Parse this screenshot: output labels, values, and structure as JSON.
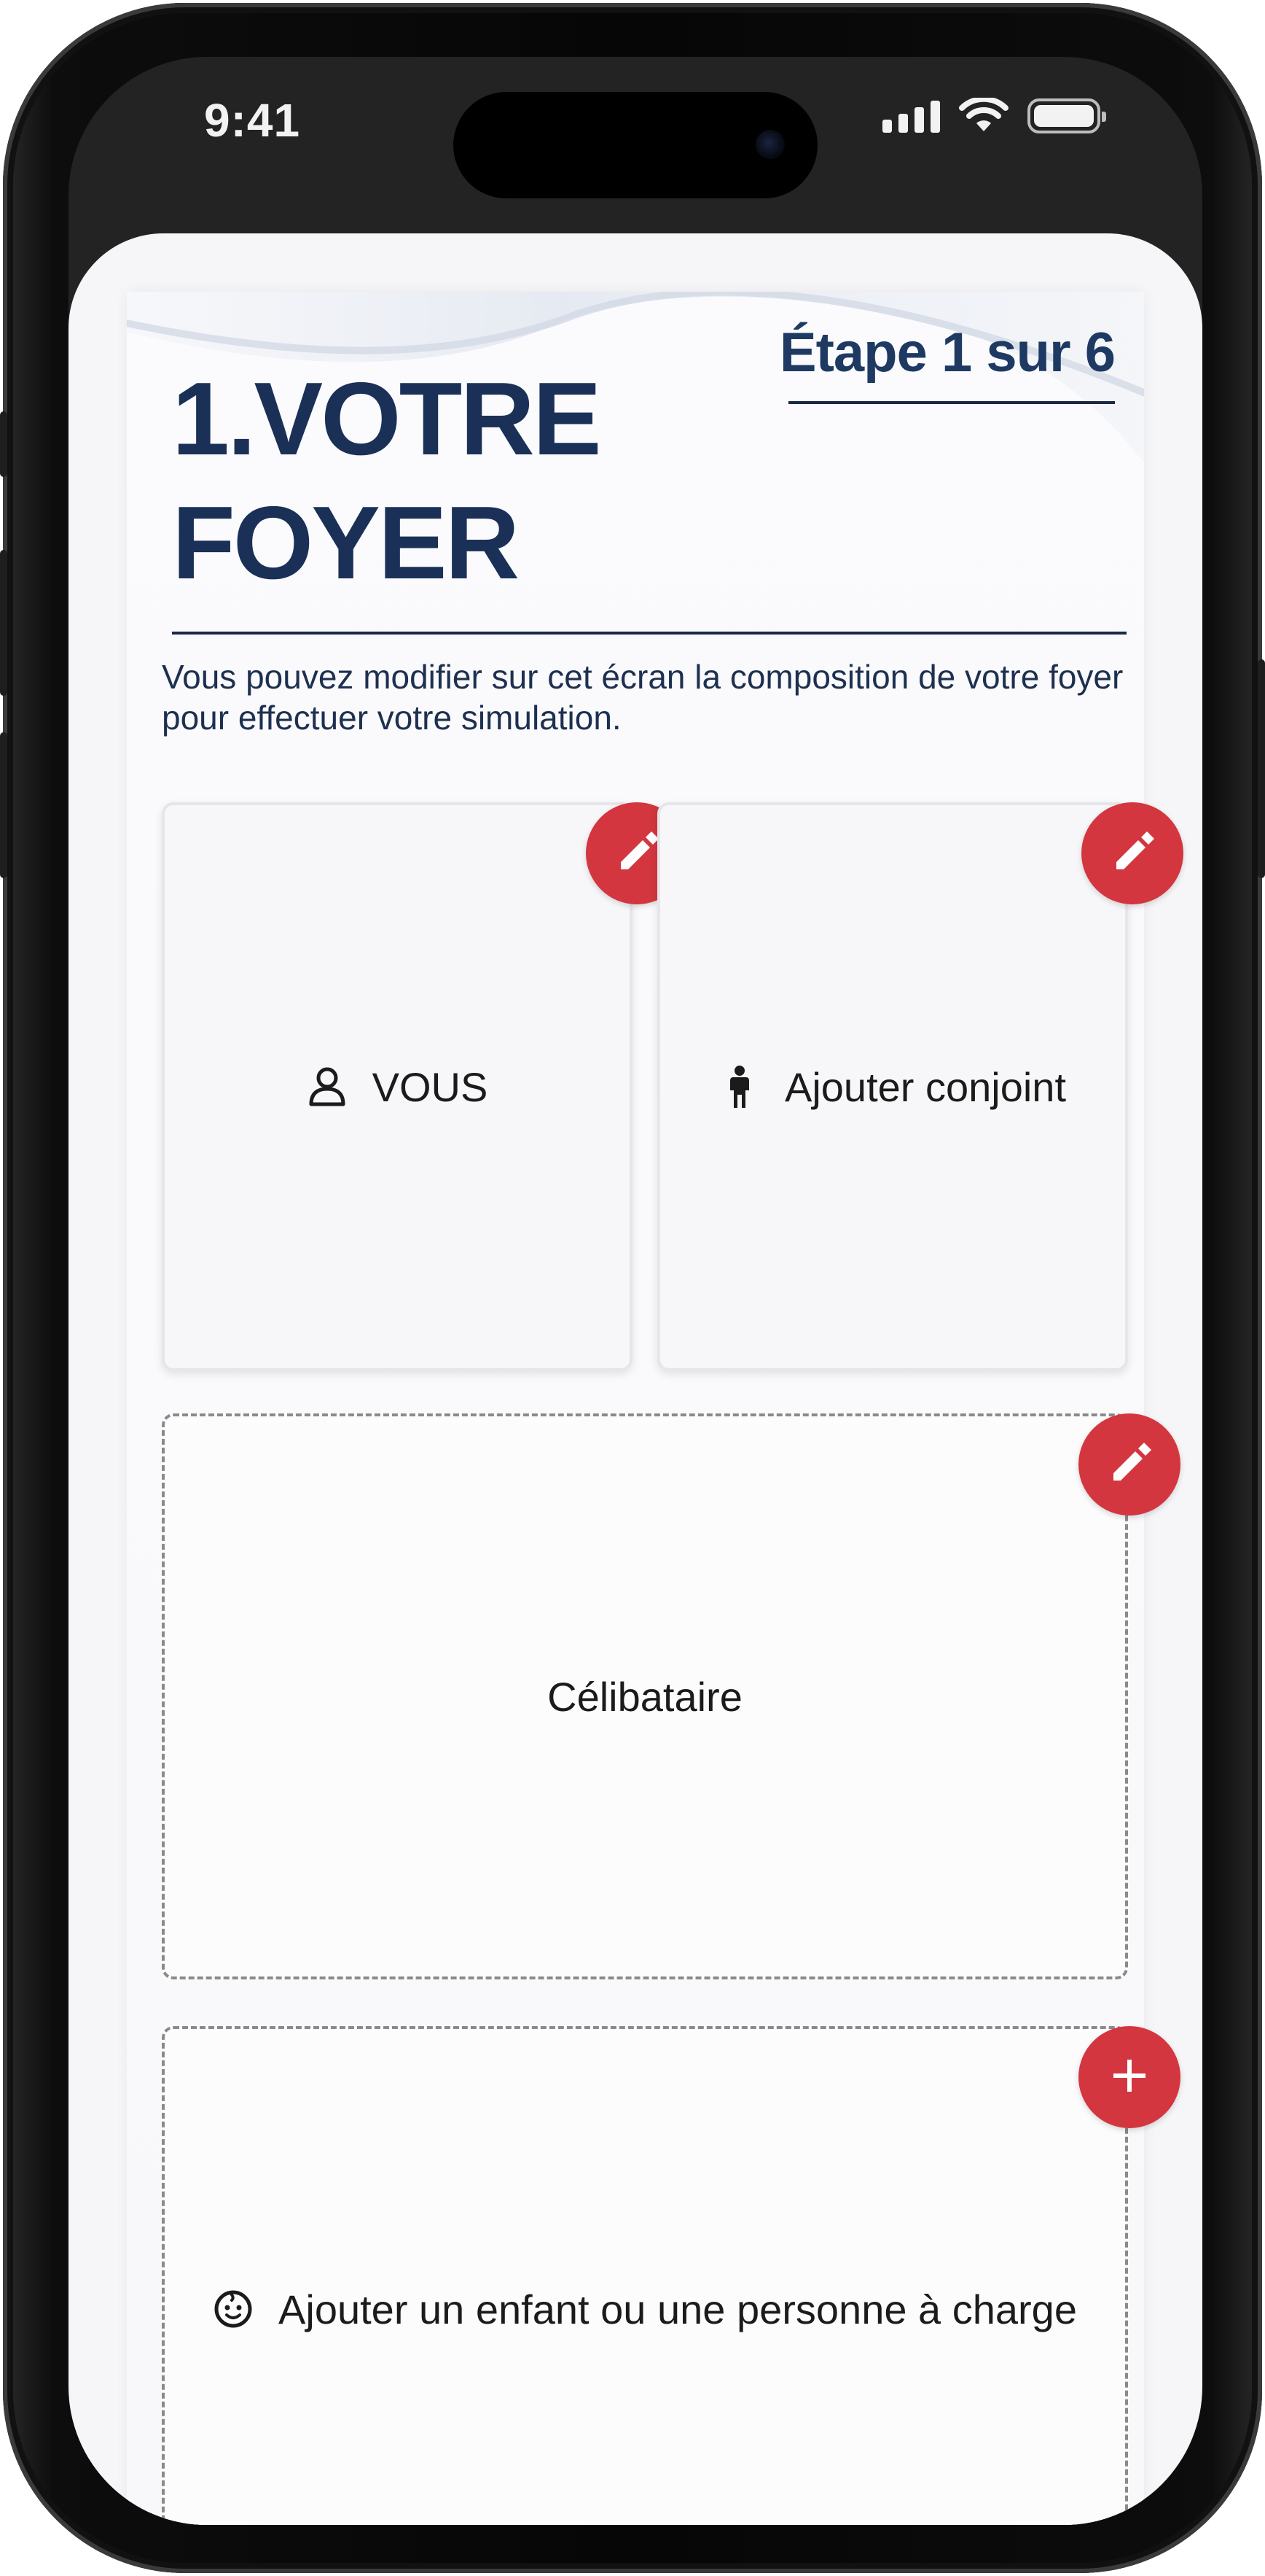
{
  "status_bar": {
    "time": "9:41"
  },
  "header": {
    "title_line1": "1.VOTRE",
    "title_line2": "FOYER",
    "step": "Étape 1 sur 6"
  },
  "intro_text": "Vous pouvez modifier sur cet écran la composition de votre foyer pour effectuer votre simulation.",
  "cards": {
    "you": {
      "label": "VOUS",
      "icon": "person-outline-icon",
      "action_icon": "pencil-icon"
    },
    "spouse": {
      "label": "Ajouter conjoint",
      "icon": "person-standing-icon",
      "action_icon": "pencil-icon"
    },
    "status": {
      "label": "Célibataire",
      "action_icon": "pencil-icon"
    },
    "dependent": {
      "label": "Ajouter un enfant ou une personne à charge",
      "icon": "baby-face-icon",
      "action_icon": "plus-icon"
    }
  },
  "colors": {
    "accent_red": "#d3363f",
    "title_navy": "#1a3057"
  }
}
